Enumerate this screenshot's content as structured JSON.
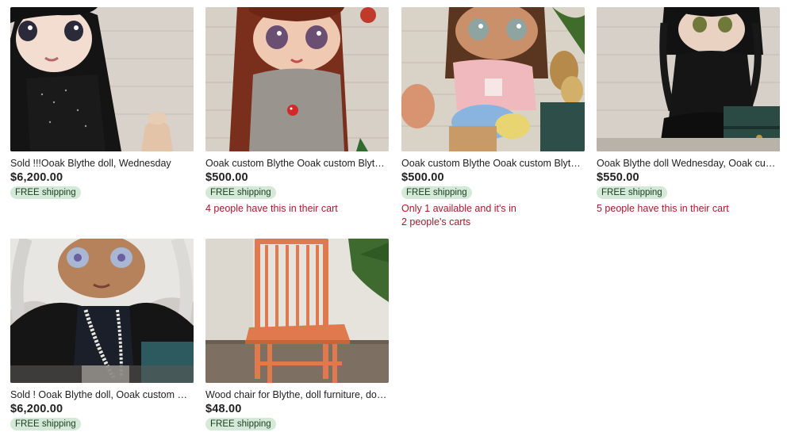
{
  "listings": [
    {
      "title": "Sold !!!Ooak Blythe doll, Wednesday",
      "price": "$6,200.00",
      "shipping": "FREE shipping",
      "note_line1": "",
      "note_line2": ""
    },
    {
      "title": "Ooak custom Blythe Ooak custom Blythe doll, blythe doll custom, blythe doll for sale",
      "price": "$500.00",
      "shipping": "FREE shipping",
      "note_line1": "4 people have this in their cart",
      "note_line2": ""
    },
    {
      "title": "Ooak custom Blythe Ooak custom Blythe doll, blythe doll custom",
      "price": "$500.00",
      "shipping": "FREE shipping",
      "note_line1": "Only 1 available and it's in",
      "note_line2": "2 people's carts"
    },
    {
      "title": "Ooak Blythe doll Wednesday, Ooak custom Blythe doll",
      "price": "$550.00",
      "shipping": "FREE shipping",
      "note_line1": "5 people have this in their cart",
      "note_line2": ""
    },
    {
      "title": "Sold ! Ooak Blythe doll, Ooak custom Blythe doll",
      "price": "$6,200.00",
      "shipping": "FREE shipping",
      "note_line1": "",
      "note_line2": ""
    },
    {
      "title": "Wood chair for Blythe, doll furniture, doll chair",
      "price": "$48.00",
      "shipping": "FREE shipping",
      "note_line1": "",
      "note_line2": ""
    }
  ]
}
